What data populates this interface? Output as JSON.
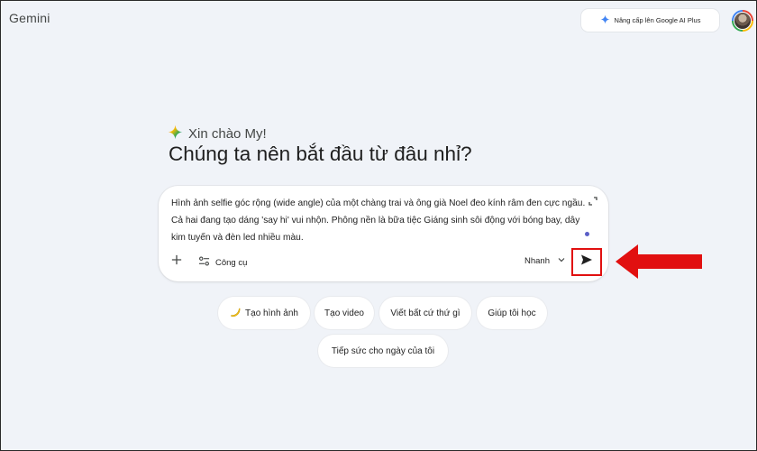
{
  "header": {
    "brand": "Gemini",
    "upgrade_label": "Nâng cấp lên Google AI Plus"
  },
  "main": {
    "greeting": "Xin chào My!",
    "headline": "Chúng ta nên bắt đầu từ đâu nhỉ?"
  },
  "composer": {
    "prompt_value": "Hình ảnh selfie góc rộng (wide angle) của một chàng trai và ông già Noel đeo kính râm đen cực ngầu. Cả hai đang tạo dáng 'say hi' vui nhộn. Phông nền là bữa tiệc Giáng sinh sôi động với bóng bay, dây kim tuyến và đèn led nhiều màu.",
    "tools_label": "Công cụ",
    "mode_label": "Nhanh",
    "icons": [
      "plus-icon",
      "tools-icon",
      "chevron-down-icon",
      "send-icon",
      "expand-icon"
    ]
  },
  "chips": [
    {
      "label": "Tạo hình ảnh",
      "icon": "banana-icon"
    },
    {
      "label": "Tạo video"
    },
    {
      "label": "Viết bất cứ thứ gì"
    },
    {
      "label": "Giúp tôi học"
    },
    {
      "label": "Tiếp sức cho ngày của tôi"
    }
  ],
  "colors": {
    "background": "#f0f3f8",
    "annotation_red": "#e11010",
    "sparkle_blue": "#4285f4"
  }
}
